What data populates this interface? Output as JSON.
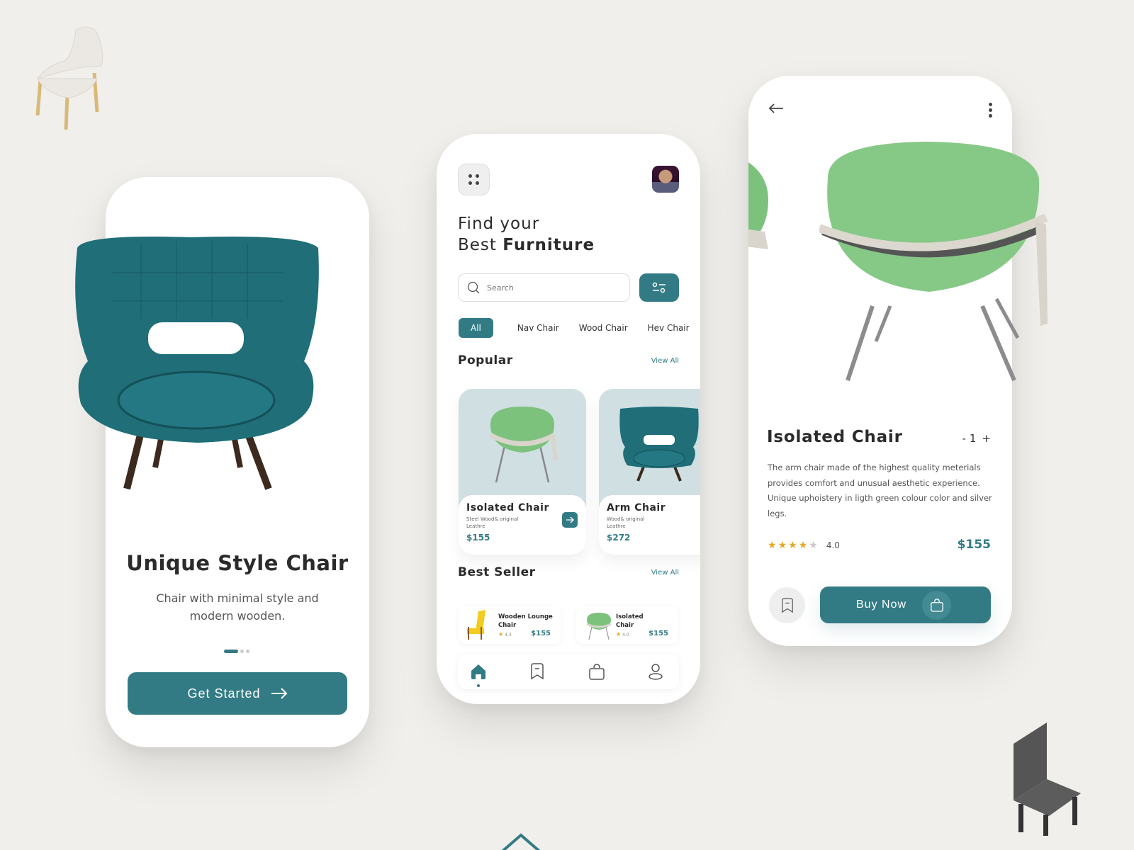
{
  "colors": {
    "accent": "#337b84",
    "background": "#f1efeb",
    "star": "#e8a823"
  },
  "onboarding": {
    "title": "Unique Style Chair",
    "subtitle": "Chair with minimal style and modern wooden.",
    "page_indicator": {
      "current": 1,
      "total": 3
    },
    "cta_label": "Get Started",
    "cta_icon": "arrow-right-icon"
  },
  "home": {
    "menu_icon": "grid-dots-icon",
    "avatar": "user-avatar",
    "title_line1": "Find your",
    "title_line2_prefix": "Best ",
    "title_line2_bold": "Furniture",
    "search": {
      "placeholder": "Search",
      "icon": "search-icon"
    },
    "filter_icon": "sliders-icon",
    "categories": [
      "All",
      "Nav Chair",
      "Wood Chair",
      "Hev Chair"
    ],
    "selected_category": "All",
    "popular": {
      "title": "Popular",
      "view_all": "View All",
      "items": [
        {
          "name": "Isolated Chair",
          "desc": "Steel Wood& original Leathre",
          "price": "$155"
        },
        {
          "name": "Arm Chair",
          "desc": "Wood& original Leathre",
          "price": "$272"
        }
      ]
    },
    "best_seller": {
      "title": "Best Seller",
      "view_all": "View All",
      "items": [
        {
          "name": "Wooden Lounge Chair",
          "rating": "4.3",
          "price": "$155"
        },
        {
          "name": "Isolated Chair",
          "rating": "4.0",
          "price": "$155"
        }
      ]
    },
    "nav": [
      "home-icon",
      "bookmark-icon",
      "bag-icon",
      "profile-icon"
    ],
    "active_nav": "home-icon"
  },
  "detail": {
    "back_icon": "arrow-left-icon",
    "more_icon": "more-vertical-icon",
    "name": "Isolated Chair",
    "qty_minus": "-",
    "qty_value": "1",
    "qty_plus": "+",
    "description": "The arm chair made of the highest quality meterials provides comfort and unusual aesthetic experience. Unique uphoistery in ligth green colour color and silver legs.",
    "rating": "4.0",
    "rating_stars": 4,
    "rating_max": 5,
    "price": "$155",
    "buy_label": "Buy Now"
  }
}
